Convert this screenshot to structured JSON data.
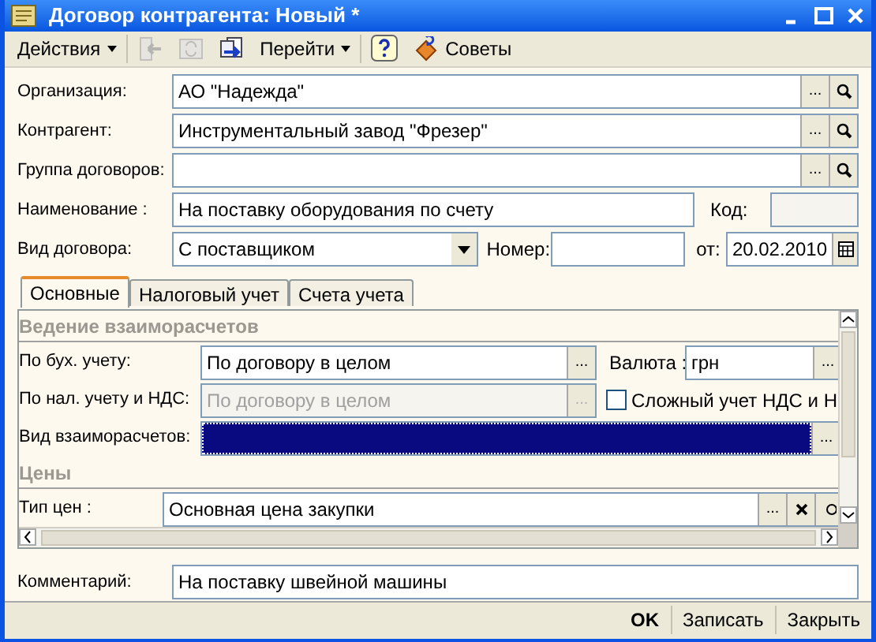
{
  "window": {
    "title": "Договор контрагента: Новый *"
  },
  "toolbar": [
    {
      "kind": "menu",
      "label": "Действия",
      "disabled": false
    },
    {
      "kind": "icon",
      "disabled": true
    },
    {
      "kind": "icon",
      "disabled": true
    },
    {
      "kind": "icon",
      "disabled": false
    },
    {
      "kind": "menu",
      "label": "Перейти",
      "disabled": false
    },
    {
      "kind": "icon",
      "disabled": false
    },
    {
      "kind": "labeled",
      "label": "Советы",
      "disabled": false
    }
  ],
  "fields": [
    {
      "label": "Организация:",
      "value": "АО \"Надежда\"",
      "buttons": [
        {
          "kind": "select",
          "label": "..."
        },
        {
          "kind": "search"
        }
      ]
    },
    {
      "label": "Контрагент:",
      "value": "Инструментальный завод \"Фрезер\"",
      "buttons": [
        {
          "kind": "select",
          "label": "..."
        },
        {
          "kind": "search"
        }
      ]
    },
    {
      "label": "Группа договоров:",
      "buttons": [
        {
          "kind": "select",
          "label": "..."
        },
        {
          "kind": "search"
        }
      ]
    }
  ],
  "name_row": {
    "label": "Наименование :",
    "value": "На поставку оборудования по счету",
    "code_label": "Код:"
  },
  "type_row": {
    "label": "Вид договора:",
    "value": "С поставщиком",
    "number_label": "Номер:",
    "date_label": "от:",
    "date": "20.02.2010"
  },
  "tabs": [
    {
      "label": "Основные",
      "selected": true
    },
    {
      "label": "Налоговый учет",
      "selected": false
    },
    {
      "label": "Счета учета",
      "selected": false
    }
  ],
  "sections": [
    {
      "title": "Ведение взаиморасчетов",
      "rows": [
        {
          "kind": "field_with_currency",
          "label": "По бух. учету:",
          "value": "По договору в целом",
          "disabled": false,
          "buttons": [
            {
              "kind": "select",
              "label": "..."
            }
          ],
          "side_label": "Валюта :",
          "side_value": "грн",
          "side_buttons": [
            {
              "kind": "select",
              "label": "..."
            }
          ]
        },
        {
          "kind": "field_with_check",
          "label": "По нал. учету и НДС:",
          "value": "По договору в целом",
          "disabled": true,
          "buttons": [
            {
              "kind": "select",
              "label": "..."
            }
          ],
          "check_label": "Сложный  учет НДС и Н",
          "checked": false
        },
        {
          "kind": "wide",
          "label": "Вид взаиморасчетов:",
          "focused": true,
          "disabled": false,
          "buttons": [
            {
              "kind": "select",
              "label": "..."
            }
          ]
        }
      ]
    },
    {
      "title": "Цены",
      "rows": [
        {
          "kind": "price",
          "label": "Тип цен :",
          "value": "Основная цена закупки",
          "disabled": false,
          "buttons": [
            {
              "kind": "select",
              "label": "..."
            },
            {
              "kind": "clear"
            },
            {
              "kind": "open"
            }
          ]
        }
      ]
    }
  ],
  "comment": {
    "label": "Комментарий:",
    "value": "На поставку швейной машины"
  },
  "footer": [
    {
      "label": "OK",
      "default": true
    },
    {
      "label": "Записать",
      "default": false
    },
    {
      "label": "Закрыть",
      "default": false
    }
  ]
}
